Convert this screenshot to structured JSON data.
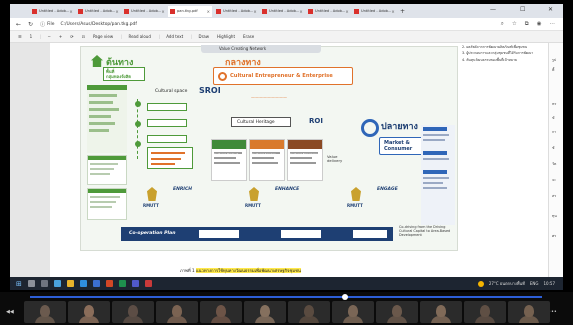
{
  "browser": {
    "tabs": [
      {
        "label": "Untitled - Adob..."
      },
      {
        "label": "Untitled - Adob..."
      },
      {
        "label": "Untitled - Adob..."
      },
      {
        "label": "pan.tkg.pdf",
        "active": true
      },
      {
        "label": "Untitled - Adob..."
      },
      {
        "label": "Untitled - Adob..."
      },
      {
        "label": "Untitled - Adob..."
      },
      {
        "label": "Untitled - Adob..."
      }
    ],
    "new_tab": "+",
    "minimize": "—",
    "maximize": "☐",
    "close": "✕",
    "address_label": "File",
    "url": "C:/Users/Asus/Desktop/pan.tkg.pdf",
    "pdf_toolbar": [
      "Page view",
      "Read aloud",
      "Add text",
      "Draw",
      "Highlight",
      "Erase"
    ]
  },
  "diagram": {
    "header": "Value Creating Network",
    "upstream_title": "ต้นทาง",
    "upstream_sub": "พื้นที่\nกลุ่มหลงจังสิต",
    "midstream_title": "กลางทาง",
    "midstream_sub": "Cultural Entrepreneur & Enterprise",
    "downstream_title": "ปลายทาง",
    "downstream_sub": "Market &\nConsumer",
    "cultural_space": "Cultural space",
    "sroi": "SROI",
    "roi": "ROI",
    "cultural_heritage": "Cultural Heritage",
    "value_delivery": "Value\ndelivery",
    "cooperation": "Co-operation Plan",
    "enrich": "ENRICH",
    "enhance": "ENHANCE",
    "engage": "ENGAGE",
    "rmutt": "RMUTT",
    "right_note": "Co-driving from the Driving Cultural Capital to Area-Based Development",
    "col_labels": [
      "Cultural Product",
      "Cultural Service",
      "Cultural Experience"
    ]
  },
  "caption": {
    "prefix": "ภาพที่ 1 ",
    "highlight": "แนวทางการใช้ทุนทางวัฒนธรรมเพื่อพัฒนาเศรษฐกิจชุมชน"
  },
  "side_notes": [
    "2. ผลลัพธ์จากการพัฒนาผลิตภัณฑ์เพื่อชุมชน",
    "3. ผู้ประกอบการและกลุ่มชุมชนที่ได้รับการพัฒนา",
    "4. ต้นทุนวัฒนธรรมของพื้นที่เป้าหมาย"
  ],
  "taskbar": {
    "weather": "27°C ฝนตกบางพื้นที่",
    "time": "10:57",
    "lang": "ENG"
  },
  "colors": {
    "green": "#4e9a3a",
    "orange": "#e0722b",
    "navy": "#1e3f73",
    "blue": "#2f66b8",
    "highlight": "#ffe94a"
  }
}
